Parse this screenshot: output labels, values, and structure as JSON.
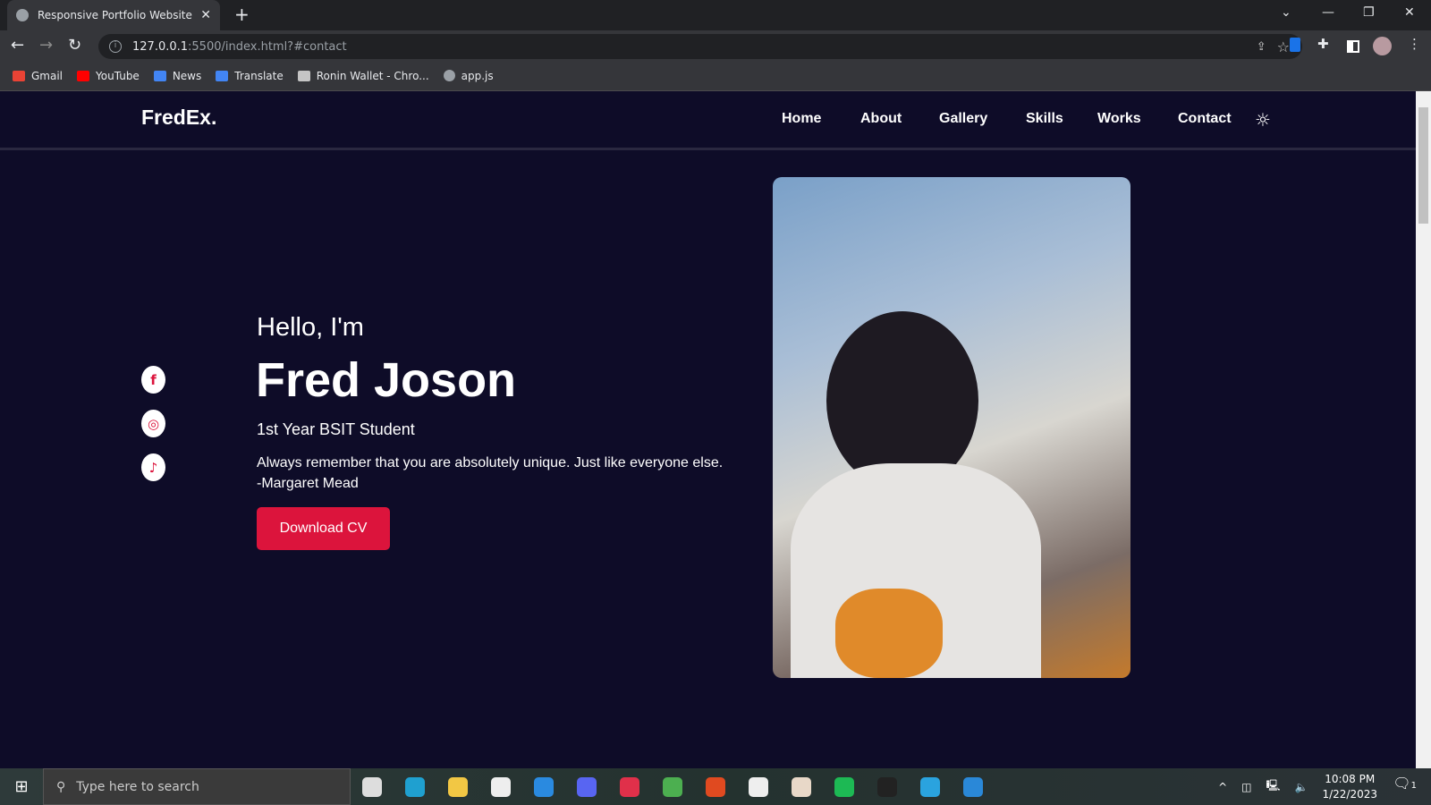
{
  "browser": {
    "tab_title": "Responsive Portfolio Website",
    "url_host": "127.0.0.1",
    "url_rest": ":5500/index.html?#contact",
    "bookmarks": [
      {
        "label": "Gmail",
        "color": "#ea4335"
      },
      {
        "label": "YouTube",
        "color": "#ff0000"
      },
      {
        "label": "News",
        "color": "#4285f4"
      },
      {
        "label": "Translate",
        "color": "#4285f4"
      },
      {
        "label": "Ronin Wallet - Chro...",
        "color": "#c5c5c5"
      },
      {
        "label": "app.js",
        "color": "#9aa0a6"
      }
    ]
  },
  "site": {
    "logo": "FredEx.",
    "nav": [
      "Home",
      "About",
      "Gallery",
      "Skills",
      "Works",
      "Contact"
    ],
    "theme_icon": "sun-icon",
    "socials": [
      {
        "name": "facebook",
        "glyph": "f"
      },
      {
        "name": "instagram",
        "glyph": "◎"
      },
      {
        "name": "tiktok",
        "glyph": "♪"
      }
    ],
    "hero": {
      "greeting": "Hello, I'm",
      "name": "Fred Joson",
      "role": "1st Year BSIT Student",
      "quote": "Always remember that you are absolutely unique. Just like everyone else.",
      "author": "-Margaret Mead",
      "cta": "Download CV"
    },
    "accent": "#dc143c",
    "background": "#0e0c28"
  },
  "taskbar": {
    "search_placeholder": "Type here to search",
    "time": "10:08 PM",
    "date": "1/22/2023",
    "notifications": "1",
    "apps": [
      {
        "name": "task-view",
        "color": "#ddd"
      },
      {
        "name": "edge",
        "color": "#1fa0d0"
      },
      {
        "name": "file-explorer",
        "color": "#f2c744"
      },
      {
        "name": "store",
        "color": "#eee"
      },
      {
        "name": "mail",
        "color": "#2a8ae0"
      },
      {
        "name": "discord",
        "color": "#5865f2"
      },
      {
        "name": "valorant",
        "color": "#e0304a"
      },
      {
        "name": "chrome",
        "color": "#4caf50"
      },
      {
        "name": "office",
        "color": "#e04a20"
      },
      {
        "name": "app-1",
        "color": "#eee"
      },
      {
        "name": "app-2",
        "color": "#e8d8c8"
      },
      {
        "name": "spotify",
        "color": "#1db954"
      },
      {
        "name": "app-3",
        "color": "#222"
      },
      {
        "name": "telegram",
        "color": "#2aa3df"
      },
      {
        "name": "vscode",
        "color": "#2a88d8"
      }
    ]
  }
}
